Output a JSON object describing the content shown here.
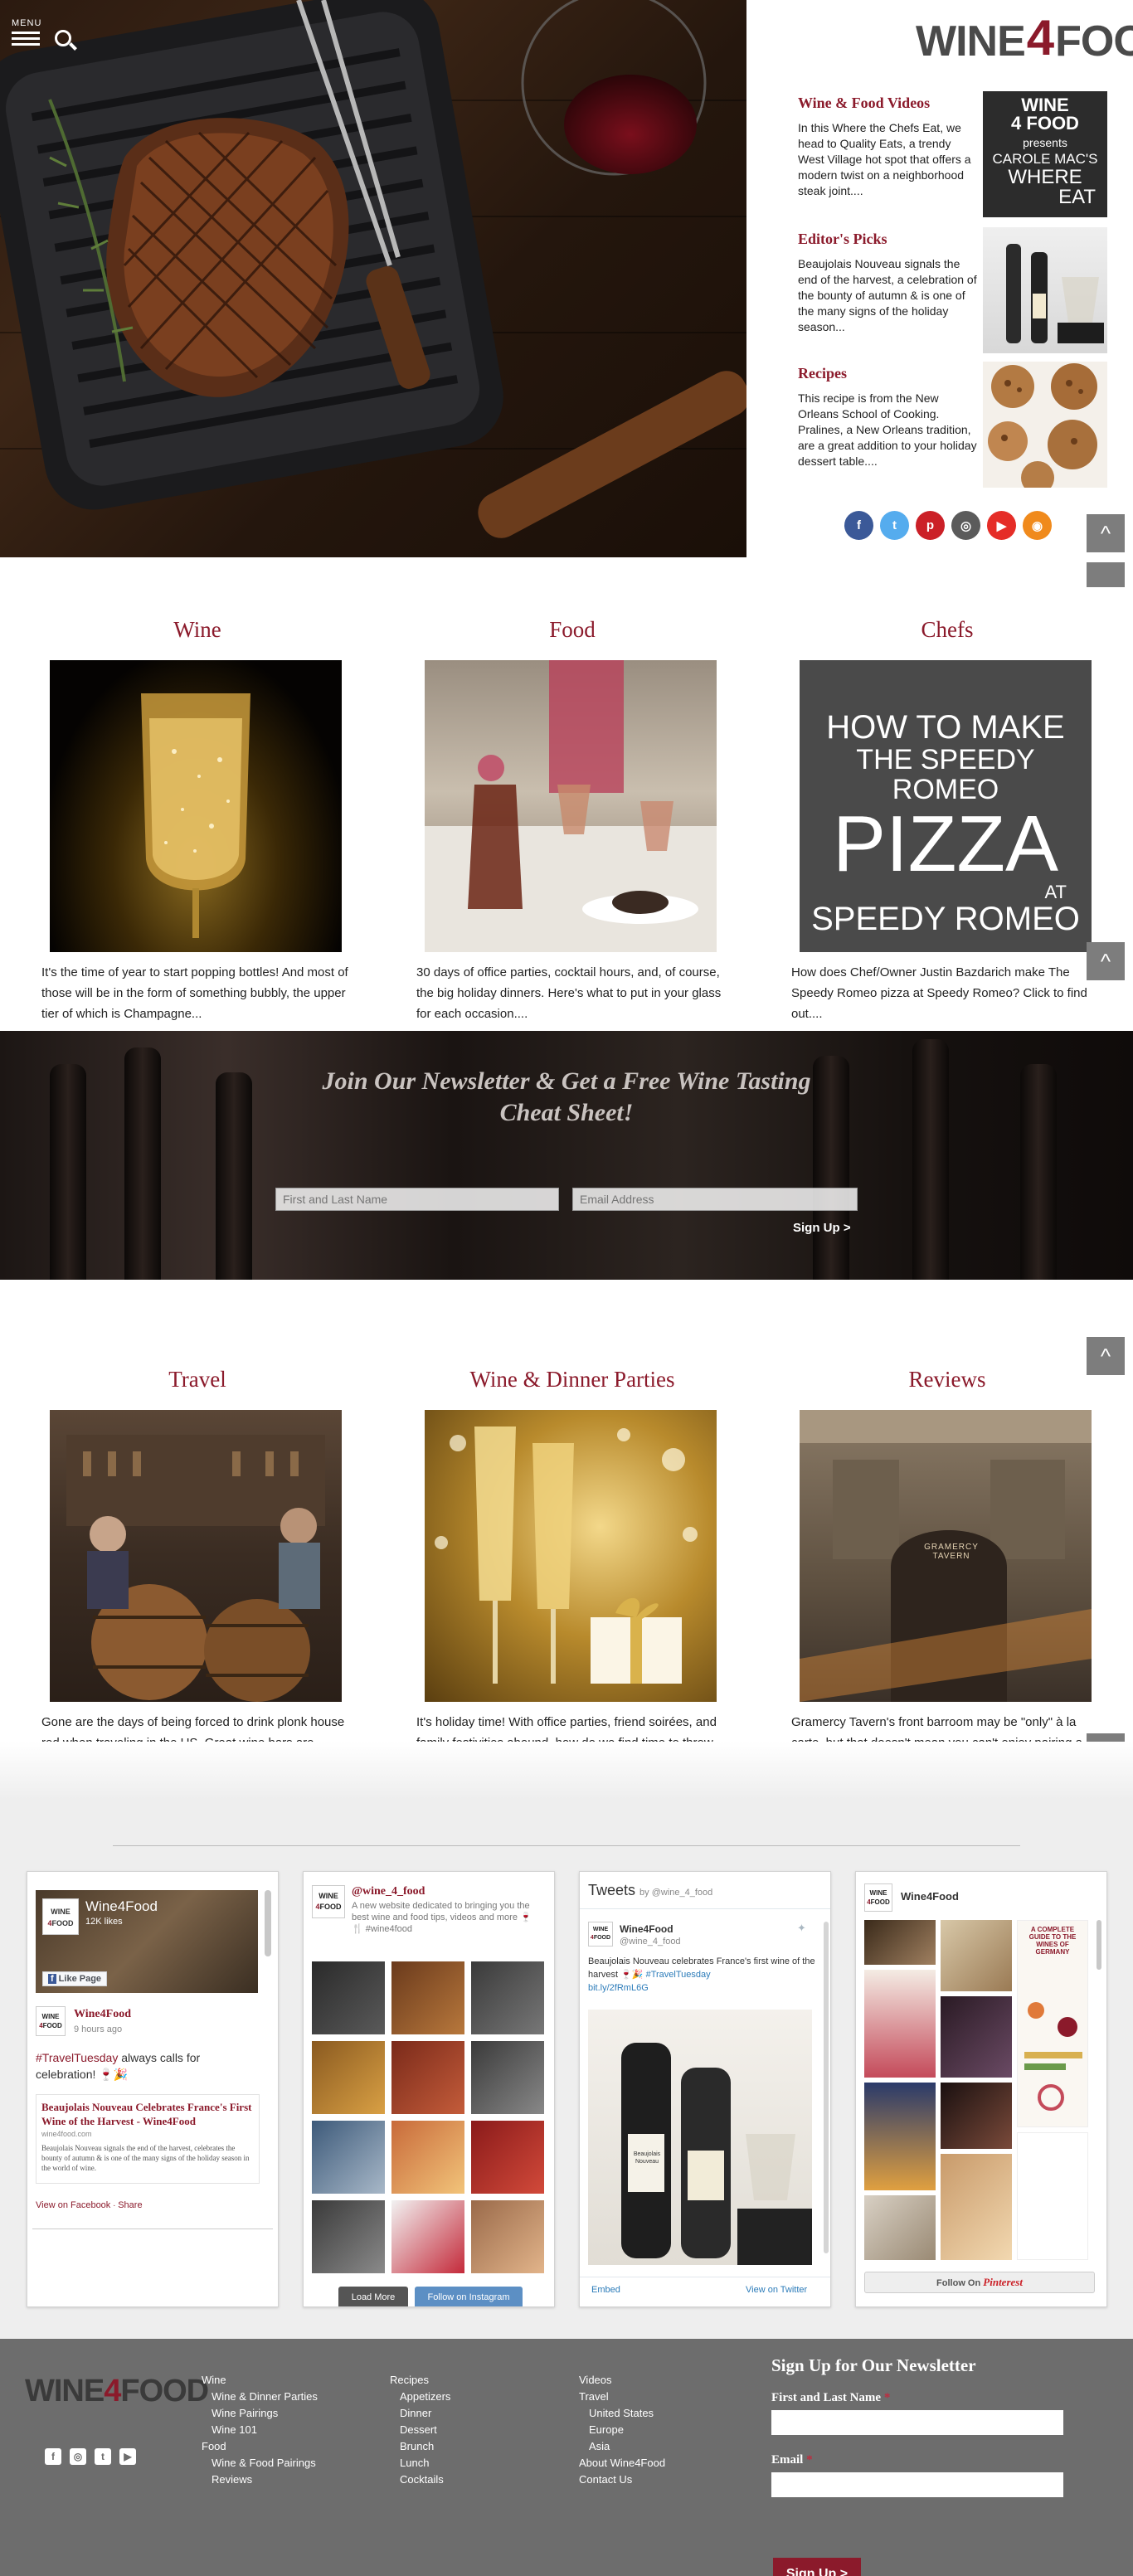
{
  "header": {
    "menu_label": "MENU",
    "logo_left": "WINE",
    "logo_mid": "4",
    "logo_right": "FOOD"
  },
  "featured": [
    {
      "title": "Wine & Food Videos",
      "text": "In this Where the Chefs Eat, we head to Quality Eats, a trendy West Village hot spot that offers a modern twist on a neighborhood steak joint....",
      "thumb_lines": [
        "WINE",
        "4 FOOD",
        "presents",
        "CAROLE MAC'S",
        "WHERE",
        "EAT"
      ]
    },
    {
      "title": "Editor's Picks",
      "text": "Beaujolais Nouveau signals the end of the harvest, a celebration of the bounty of autumn & is one of the many signs of the holiday season..."
    },
    {
      "title": "Recipes",
      "text": "This recipe is from the New Orleans School of Cooking. Pralines, a New Orleans tradition, are a great addition to your holiday dessert table...."
    }
  ],
  "social": [
    {
      "name": "facebook",
      "glyph": "f",
      "color": "#3b5998"
    },
    {
      "name": "twitter",
      "glyph": "t",
      "color": "#55acee"
    },
    {
      "name": "pinterest",
      "glyph": "p",
      "color": "#cb2027"
    },
    {
      "name": "instagram",
      "glyph": "◎",
      "color": "#5b5b5b"
    },
    {
      "name": "youtube",
      "glyph": "▶",
      "color": "#e52d27"
    },
    {
      "name": "rss",
      "glyph": "◉",
      "color": "#f08a1c"
    }
  ],
  "scroll_tab_glyph": "^",
  "categories_row1": [
    {
      "title": "Wine",
      "text": "It's the time of year to start popping bottles! And most of those will be in the form of something bubbly, the upper tier of which is Champagne..."
    },
    {
      "title": "Food",
      "text": "30 days of office parties, cocktail hours, and, of course, the big holiday dinners. Here's what to put in your glass for each occasion...."
    },
    {
      "title": "Chefs",
      "text": "How does Chef/Owner Justin Bazdarich make The Speedy Romeo pizza at Speedy Romeo? Click to find out....",
      "img_lines": [
        "HOW TO MAKE",
        "THE SPEEDY ROMEO",
        "PIZZA",
        "AT",
        "SPEEDY ROMEO"
      ]
    }
  ],
  "newsletter_band": {
    "heading_1": "Join Our Newsletter & Get a Free Wine Tasting",
    "heading_2": "Cheat Sheet!",
    "name_placeholder": "First and Last Name",
    "email_placeholder": "Email Address",
    "submit": "Sign Up >"
  },
  "categories_row2": [
    {
      "title": "Travel",
      "text": "Gone are the days of being forced to drink plonk house red when traveling in the US. Great wine bars are popping up everywhere and here are 13 to seek..."
    },
    {
      "title": "Wine & Dinner Parties",
      "text": "It's holiday time! With office parties, friend soirées, and family festivities abound, how do we find time to throw a party of our own? Here's how...."
    },
    {
      "title": "Reviews",
      "text": "Gramercy Tavern's front barroom may be \"only\" à la carte, but that doesn't mean you can't enjoy pairing a few boozy drinks with your dessert...",
      "sign": "GRAMERCY TAVERN"
    }
  ],
  "widgets": {
    "facebook": {
      "page_name": "Wine4Food",
      "likes": "12K likes",
      "like_button": "Like Page",
      "post_author": "Wine4Food",
      "post_time": "9 hours ago",
      "post_hashtag": "#TravelTuesday",
      "post_text": " always calls for celebration! 🍷🎉",
      "link_title": "Beaujolais Nouveau Celebrates France's First Wine of the Harvest - Wine4Food",
      "link_domain": "wine4food.com",
      "link_desc": "Beaujolais Nouveau signals the end of the harvest, celebrates the bounty of autumn & is one of the many signs of the holiday season in the world of wine.",
      "view_on": "View on Facebook",
      "share": "Share"
    },
    "instagram": {
      "handle": "@wine_4_food",
      "bio": "A new website dedicated to bringing you the best wine and food tips, videos and more 🍷 🍴 #wine4food",
      "load_more": "Load More",
      "follow": "Follow on Instagram"
    },
    "twitter": {
      "header": "Tweets",
      "by": "by @wine_4_food",
      "author": "Wine4Food",
      "handle": "@wine_4_food",
      "text": "Beaujolais Nouveau celebrates France's first wine of the harvest 🍷🎉 ",
      "hashtag": "#TravelTuesday",
      "link": "bit.ly/2fRmL6G",
      "bottle_label": "Beaujolais Nouveau",
      "embed": "Embed",
      "view_on": "View on Twitter"
    },
    "pinterest": {
      "name": "Wine4Food",
      "pin_text": "A COMPLETE GUIDE TO THE WINES OF GERMANY",
      "follow": "Follow On",
      "brand": "Pinterest"
    }
  },
  "footer": {
    "logo_left": "WINE",
    "logo_mid": "4",
    "logo_right": "FOOD",
    "social_glyphs": [
      "f",
      "◎",
      "t",
      "▶"
    ],
    "col1": [
      {
        "label": "Wine",
        "sub": false
      },
      {
        "label": "Wine & Dinner Parties",
        "sub": true
      },
      {
        "label": "Wine Pairings",
        "sub": true
      },
      {
        "label": "Wine 101",
        "sub": true
      },
      {
        "label": "Food",
        "sub": false
      },
      {
        "label": "Wine & Food Pairings",
        "sub": true
      },
      {
        "label": "Reviews",
        "sub": true
      }
    ],
    "col2": [
      {
        "label": "Recipes",
        "sub": false
      },
      {
        "label": "Appetizers",
        "sub": true
      },
      {
        "label": "Dinner",
        "sub": true
      },
      {
        "label": "Dessert",
        "sub": true
      },
      {
        "label": "Brunch",
        "sub": true
      },
      {
        "label": "Lunch",
        "sub": true
      },
      {
        "label": "Cocktails",
        "sub": true
      }
    ],
    "col3": [
      {
        "label": "Videos",
        "sub": false
      },
      {
        "label": "Travel",
        "sub": false
      },
      {
        "label": "United States",
        "sub": true
      },
      {
        "label": "Europe",
        "sub": true
      },
      {
        "label": "Asia",
        "sub": true
      },
      {
        "label": "About Wine4Food",
        "sub": false
      },
      {
        "label": "Contact Us",
        "sub": false
      }
    ],
    "form": {
      "title": "Sign Up for Our Newsletter",
      "name_label": "First and Last Name",
      "email_label": "Email",
      "required": "*",
      "submit": "Sign Up >"
    }
  },
  "colors": {
    "brand": "#8b1a2b",
    "footer_bg": "#6d6d6d",
    "widget_bg": "#eeeeee"
  }
}
